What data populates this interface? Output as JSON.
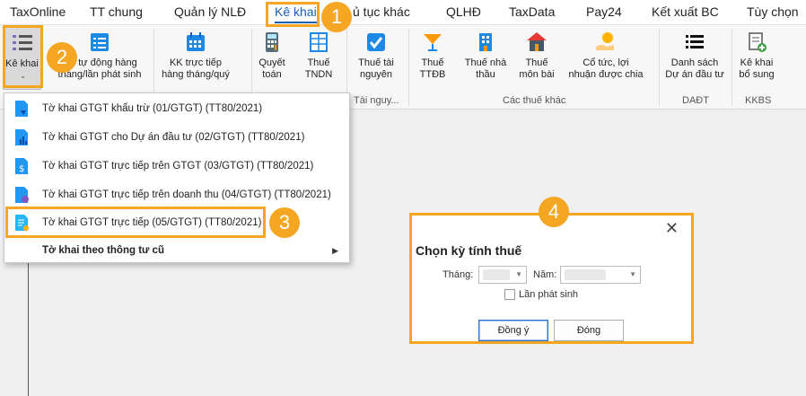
{
  "menubar": {
    "items": [
      {
        "label": "TaxOnline"
      },
      {
        "label": "TT chung"
      },
      {
        "label": "Quản lý NLĐ"
      },
      {
        "label": "Kê khai"
      },
      {
        "label": "ủ tục khác"
      },
      {
        "label": "QLHĐ"
      },
      {
        "label": "TaxData"
      },
      {
        "label": "Pay24"
      },
      {
        "label": "Kết xuất BC"
      },
      {
        "label": "Tùy chọn"
      }
    ]
  },
  "ribbon": {
    "buttons": [
      {
        "line1": "Kê khai",
        "line2": "",
        "icon": "list-icon"
      },
      {
        "line1": "tự động hàng",
        "line2": "tháng/lần phát sinh",
        "icon": "form-list-icon"
      },
      {
        "line1": "KK trực tiếp",
        "line2": "hàng tháng/quý",
        "icon": "calendar-icon"
      },
      {
        "line1": "Quyết",
        "line2": "toán",
        "icon": "calculator-icon"
      },
      {
        "line1": "Thuế",
        "line2": "TNDN",
        "icon": "grid-table-icon"
      },
      {
        "line1": "Thuế tài",
        "line2": "nguyên",
        "icon": "checkbox-icon"
      },
      {
        "line1": "Thuế",
        "line2": "TTĐB",
        "icon": "cocktail-icon"
      },
      {
        "line1": "Thuế nhà",
        "line2": "thầu",
        "icon": "building-icon"
      },
      {
        "line1": "Thuế",
        "line2": "môn bài",
        "icon": "house-icon"
      },
      {
        "line1": "Cổ tức, lợi",
        "line2": "nhuận được chia",
        "icon": "coins-hand-icon"
      },
      {
        "line1": "Danh sách",
        "line2": "Dự án đầu tư",
        "icon": "list-bullets-icon"
      },
      {
        "line1": "Kê khai",
        "line2": "bổ sung",
        "icon": "document-add-icon"
      }
    ],
    "groups": {
      "tai_nguyen": "Tài nguy...",
      "cac_thue_khac": "Các thuế khác",
      "daut": "DAĐT",
      "kkbs": "KKBS"
    }
  },
  "dropdown": {
    "items": [
      {
        "label": "Tờ khai GTGT khấu trừ (01/GTGT) (TT80/2021)"
      },
      {
        "label": "Tờ khai GTGT cho Dự án đầu tư (02/GTGT) (TT80/2021)"
      },
      {
        "label": "Tờ khai GTGT trực tiếp trên GTGT (03/GTGT) (TT80/2021)"
      },
      {
        "label": "Tờ khai GTGT trực tiếp trên doanh thu (04/GTGT) (TT80/2021)"
      },
      {
        "label": "Tờ khai GTGT trực tiếp (05/GTGT) (TT80/2021)"
      },
      {
        "label": "Tờ khai theo thông tư cũ"
      }
    ]
  },
  "dialog": {
    "title": "Chọn kỳ tính thuế",
    "month_label": "Tháng:",
    "year_label": "Năm:",
    "checkbox_label": "Lần phát sinh",
    "ok_label": "Đồng ý",
    "close_label": "Đóng",
    "close_glyph": "✕"
  },
  "callouts": [
    "1",
    "2",
    "3",
    "4"
  ],
  "colors": {
    "accent": "#f5a623",
    "menu_active": "#1a5fb4",
    "icon_blue": "#1e88e5"
  }
}
